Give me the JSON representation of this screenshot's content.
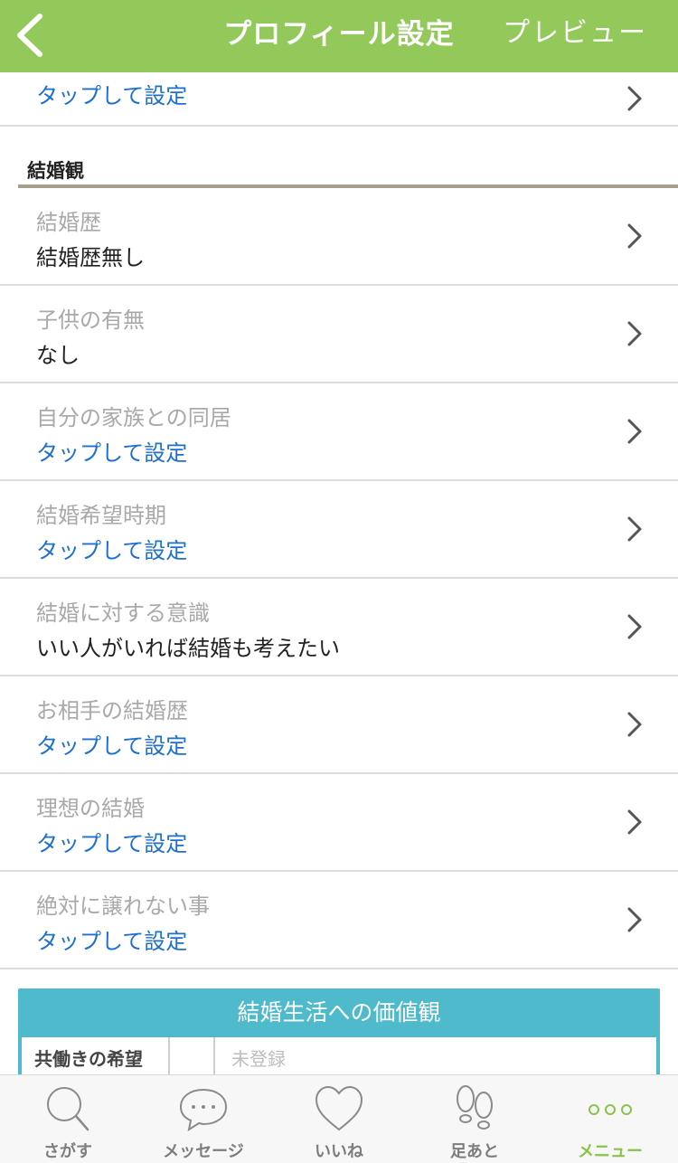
{
  "header": {
    "title": "プロフィール設定",
    "preview_label": "プレビュー",
    "color": "#93c95b"
  },
  "top_row": {
    "value": "タップして設定"
  },
  "section": {
    "title": "結婚観"
  },
  "rows": [
    {
      "label": "結婚歴",
      "value": "結婚歴無し",
      "set": true
    },
    {
      "label": "子供の有無",
      "value": "なし",
      "set": true
    },
    {
      "label": "自分の家族との同居",
      "value": "タップして設定",
      "set": false
    },
    {
      "label": "結婚希望時期",
      "value": "タップして設定",
      "set": false
    },
    {
      "label": "結婚に対する意識",
      "value": "いい人がいれば結婚も考えたい",
      "set": true
    },
    {
      "label": "お相手の結婚歴",
      "value": "タップして設定",
      "set": false
    },
    {
      "label": "理想の結婚",
      "value": "タップして設定",
      "set": false
    },
    {
      "label": "絶対に譲れない事",
      "value": "タップして設定",
      "set": false
    }
  ],
  "values_box": {
    "title": "結婚生活への価値観",
    "row_label": "共働きの希望",
    "row_value": "未登録",
    "color": "#4fbacb"
  },
  "tabbar": {
    "tabs": [
      {
        "label": "さがす",
        "icon": "search-icon"
      },
      {
        "label": "メッセージ",
        "icon": "message-icon"
      },
      {
        "label": "いいね",
        "icon": "heart-icon"
      },
      {
        "label": "足あと",
        "icon": "footprints-icon"
      },
      {
        "label": "メニュー",
        "icon": "more-icon",
        "active": true
      }
    ],
    "active_color": "#8bc34a"
  }
}
